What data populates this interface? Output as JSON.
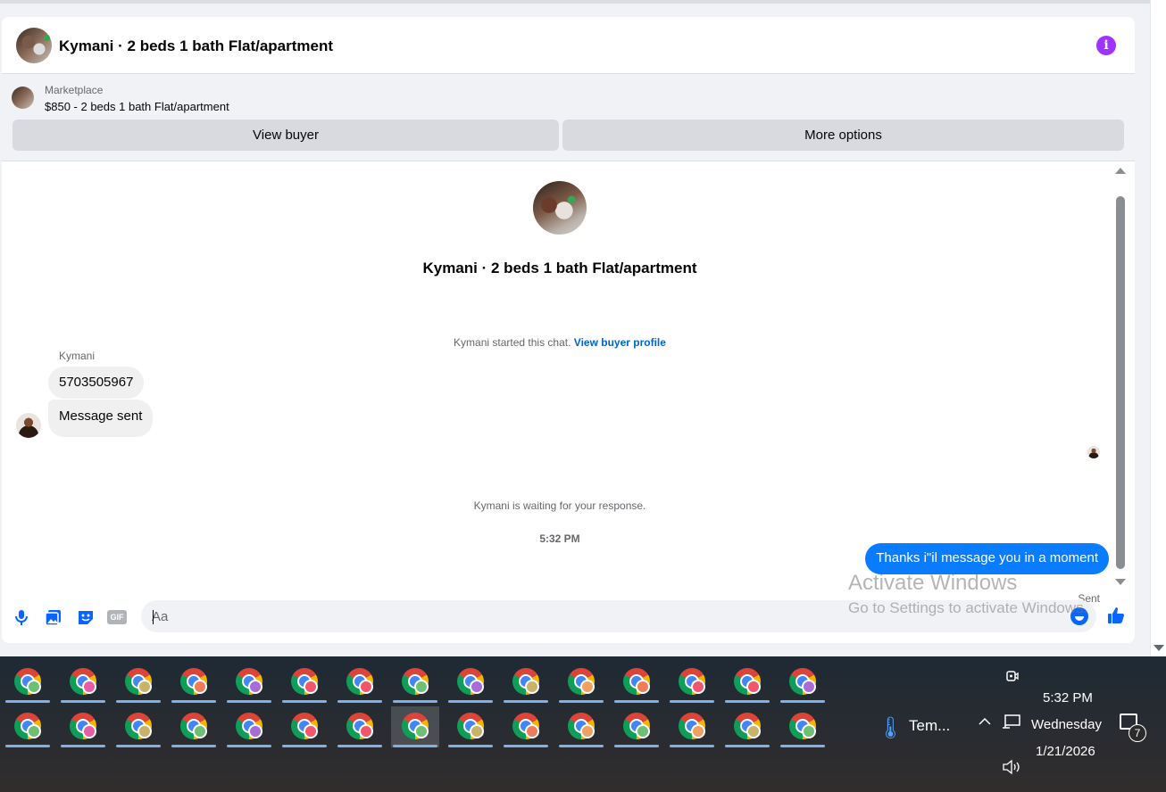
{
  "conversation": {
    "title": "Kymani · 2 beds 1 bath Flat/apartment"
  },
  "marketplace": {
    "label": "Marketplace",
    "listing": "$850 - 2 beds 1 bath Flat/apartment",
    "view_buyer": "View buyer",
    "more_options": "More options"
  },
  "chat": {
    "intro_title": "Kymani · 2 beds 1 bath Flat/apartment",
    "started_text": "Kymani started this chat.",
    "view_profile": "View buyer profile",
    "sender_name": "Kymani",
    "messages_in": [
      "5703505967",
      "Message sent"
    ],
    "waiting_text": "Kymani is waiting for your response.",
    "timestamp": "5:32 PM",
    "message_out": "Thanks i\"il message you in a moment",
    "sent_status": "Sent"
  },
  "composer": {
    "placeholder": "Aa",
    "gif_label": "GIF"
  },
  "watermark": {
    "line1": "Activate Windows",
    "line2": "Go to Settings to activate Windows."
  },
  "taskbar": {
    "weather": "Tem...",
    "time": "5:32 PM",
    "day": "Wednesday",
    "date": "1/21/2026",
    "notification_count": "7",
    "profile_badge_colors_row1": [
      "#6fbf73",
      "#e95ca5",
      "#c9b26a",
      "#f07b5a",
      "#a86bd8",
      "#f0566c",
      "#f0566c",
      "#6fbf73",
      "#a86bd8",
      "#c9b26a",
      "#f0a062",
      "#f07b5a",
      "#f0566c",
      "#f0566c",
      "#a86bd8"
    ],
    "profile_badge_colors_row2": [
      "#6fbf73",
      "#e95ca5",
      "#c9b26a",
      "#6fbf73",
      "#a86bd8",
      "#f0566c",
      "#f0566c",
      "#6fbf73",
      "#c9b26a",
      "#f07b5a",
      "#f0a062",
      "#6fbf73",
      "#f0a062",
      "#c9b26a",
      "#6fbf73"
    ]
  }
}
